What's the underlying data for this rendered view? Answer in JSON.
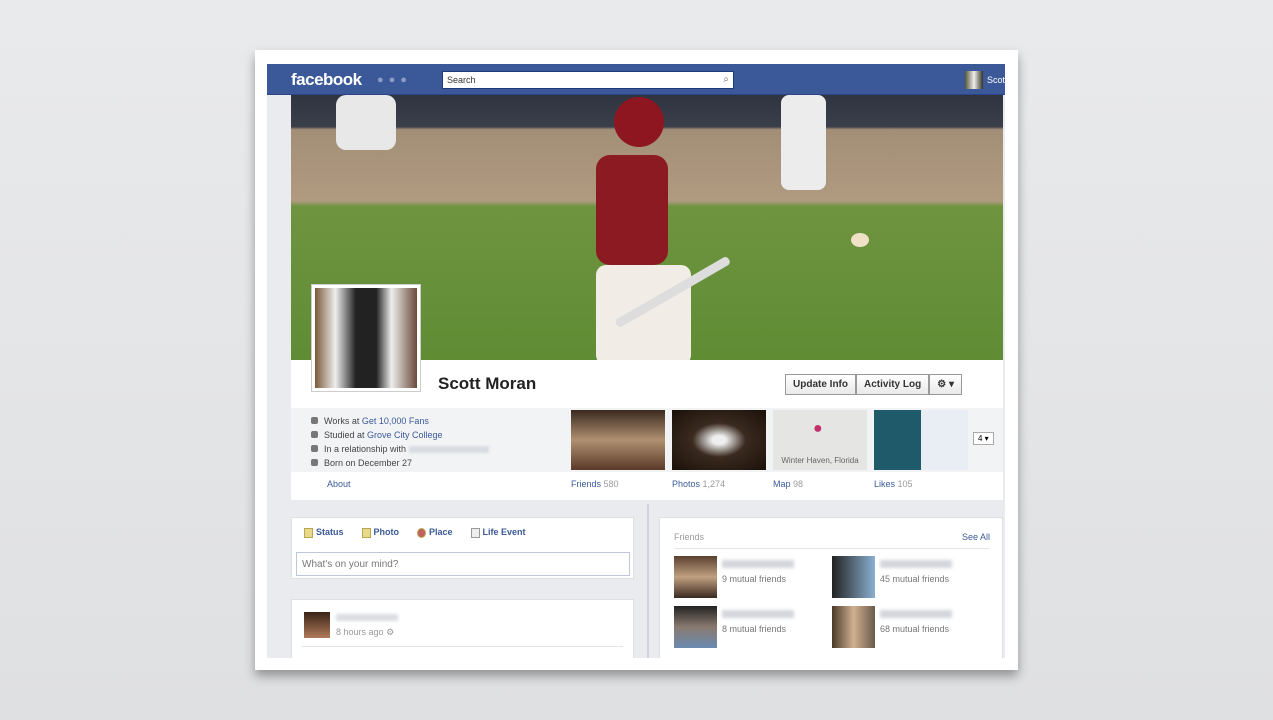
{
  "topbar": {
    "logo": "facebook",
    "search_placeholder": "Search",
    "user": "Scot"
  },
  "profile": {
    "name": "Scott Moran",
    "buttons": {
      "update_info": "Update Info",
      "activity_log": "Activity Log",
      "settings": "⚙ ▾"
    }
  },
  "info": {
    "works_prefix": "Works at ",
    "works": "Get 10,000 Fans",
    "studied_prefix": "Studied at ",
    "studied": "Grove City College",
    "relationship": "In a relationship with",
    "born": "Born on December 27",
    "about": "About"
  },
  "tiles": [
    {
      "label": "Friends",
      "count": "580"
    },
    {
      "label": "Photos",
      "count": "1,274"
    },
    {
      "label": "Map",
      "count": "98"
    },
    {
      "label": "Likes",
      "count": "105"
    }
  ],
  "map_caption": "Winter Haven, Florida",
  "more": "4 ▾",
  "composer": {
    "tabs": [
      "Status",
      "Photo",
      "Place",
      "Life Event"
    ],
    "placeholder": "What's on your mind?"
  },
  "post": {
    "time": "8 hours ago"
  },
  "friends": {
    "title": "Friends",
    "see_all": "See All",
    "items": [
      {
        "mutual": "9 mutual friends"
      },
      {
        "mutual": "45 mutual friends"
      },
      {
        "mutual": "8 mutual friends"
      },
      {
        "mutual": "68 mutual friends"
      }
    ]
  }
}
